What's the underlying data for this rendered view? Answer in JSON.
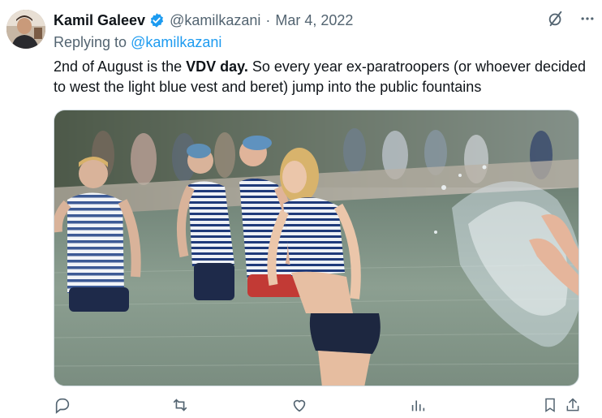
{
  "tweet": {
    "author_name": "Kamil Galeev",
    "handle": "@kamilkazani",
    "separator": "·",
    "date": "Mar 4, 2022",
    "replying_prefix": "Replying to",
    "replying_to": "@kamilkazani",
    "text_part1": "2nd of August is the ",
    "text_bold": "VDV day.",
    "text_part2": " So every year ex-paratroopers (or whoever decided to west the light blue vest and beret) jump into the public fountains"
  },
  "icons": {
    "verified": "verified-badge-icon",
    "grok": "grok-icon",
    "more": "more-icon",
    "reply": "reply-icon",
    "retweet": "retweet-icon",
    "like": "like-icon",
    "views": "views-icon",
    "bookmark": "bookmark-icon",
    "share": "share-icon"
  },
  "colors": {
    "accent": "#1d9bf0",
    "secondary_text": "#536471",
    "primary_text": "#0f1419"
  }
}
